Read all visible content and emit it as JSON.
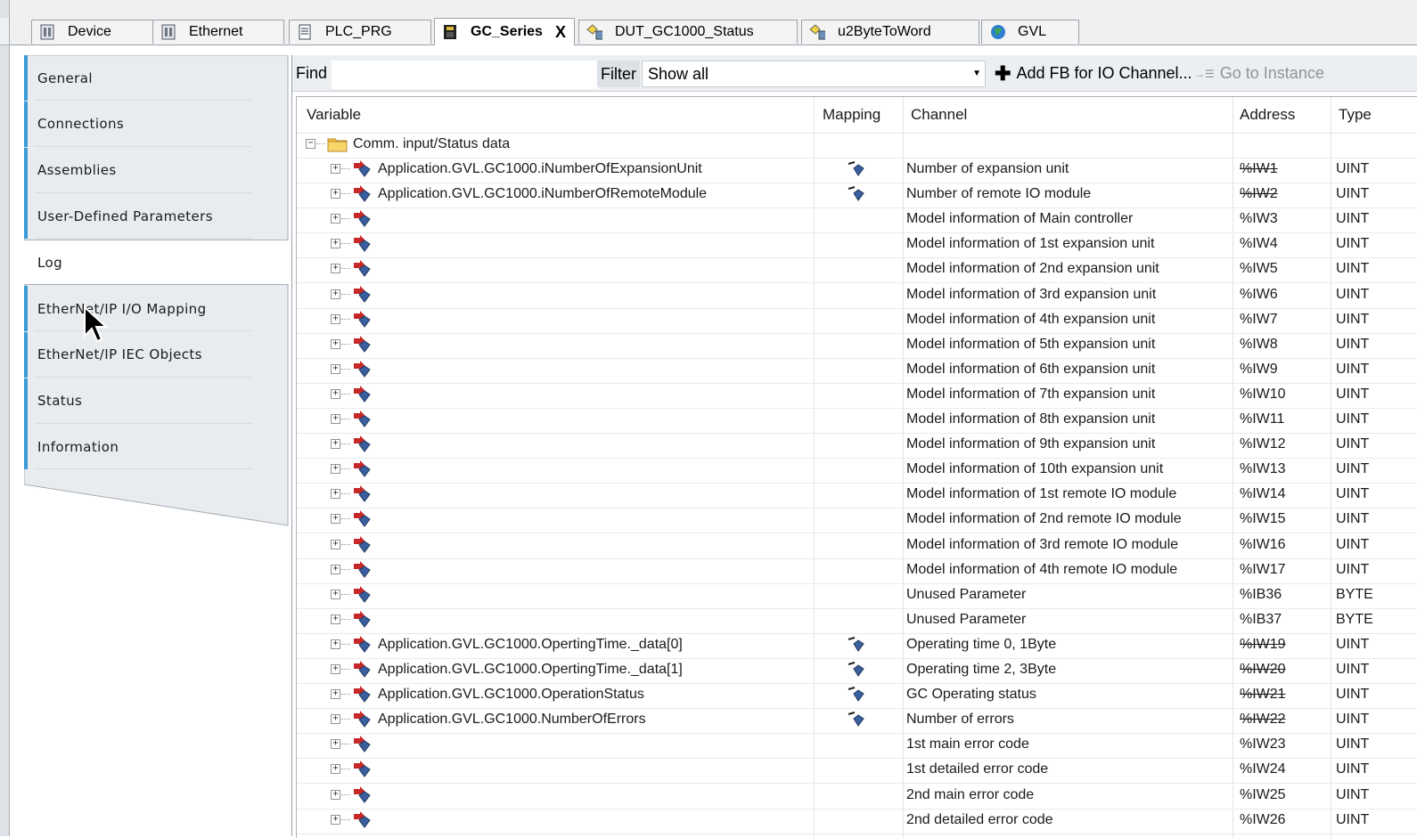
{
  "tabs": [
    {
      "label": "Device",
      "icon": "device-icon"
    },
    {
      "label": "Ethernet",
      "icon": "device-icon"
    },
    {
      "label": "PLC_PRG",
      "icon": "document-icon"
    },
    {
      "label": "GC_Series",
      "icon": "controller-icon",
      "active": true,
      "close": "X"
    },
    {
      "label": "DUT_GC1000_Status",
      "icon": "dut-icon"
    },
    {
      "label": "u2ByteToWord",
      "icon": "dut-icon"
    },
    {
      "label": "GVL",
      "icon": "globe-icon"
    }
  ],
  "nav": {
    "items": [
      {
        "label": "General"
      },
      {
        "label": "Connections"
      },
      {
        "label": "Assemblies"
      },
      {
        "label": "User-Defined Parameters"
      },
      {
        "label": "Log",
        "selected": true
      },
      {
        "label": "EtherNet/IP I/O Mapping"
      },
      {
        "label": "EtherNet/IP IEC Objects"
      },
      {
        "label": "Status"
      },
      {
        "label": "Information"
      }
    ]
  },
  "toolbar": {
    "find_label": "Find",
    "find_value": "",
    "filter_label": "Filter",
    "filter_value": "Show all",
    "add_fb_label": "Add FB for IO Channel...",
    "goto_label": "Go to Instance"
  },
  "table": {
    "headers": {
      "variable": "Variable",
      "mapping": "Mapping",
      "channel": "Channel",
      "address": "Address",
      "type": "Type"
    },
    "group_label": "Comm. input/Status data",
    "rows": [
      {
        "variable": "Application.GVL.GC1000.iNumberOfExpansionUnit",
        "mapped": true,
        "channel": "Number of expansion unit",
        "address": "%IW1",
        "struck": true,
        "type": "UINT"
      },
      {
        "variable": "Application.GVL.GC1000.iNumberOfRemoteModule",
        "mapped": true,
        "channel": "Number of remote IO module",
        "address": "%IW2",
        "struck": true,
        "type": "UINT"
      },
      {
        "variable": "",
        "mapped": false,
        "channel": "Model information of Main controller",
        "address": "%IW3",
        "struck": false,
        "type": "UINT"
      },
      {
        "variable": "",
        "mapped": false,
        "channel": "Model information of 1st expansion unit",
        "address": "%IW4",
        "struck": false,
        "type": "UINT"
      },
      {
        "variable": "",
        "mapped": false,
        "channel": "Model information of 2nd expansion unit",
        "address": "%IW5",
        "struck": false,
        "type": "UINT"
      },
      {
        "variable": "",
        "mapped": false,
        "channel": "Model information of 3rd expansion unit",
        "address": "%IW6",
        "struck": false,
        "type": "UINT"
      },
      {
        "variable": "",
        "mapped": false,
        "channel": "Model information of 4th expansion unit",
        "address": "%IW7",
        "struck": false,
        "type": "UINT"
      },
      {
        "variable": "",
        "mapped": false,
        "channel": "Model information of 5th expansion unit",
        "address": "%IW8",
        "struck": false,
        "type": "UINT"
      },
      {
        "variable": "",
        "mapped": false,
        "channel": "Model information of 6th expansion unit",
        "address": "%IW9",
        "struck": false,
        "type": "UINT"
      },
      {
        "variable": "",
        "mapped": false,
        "channel": "Model information of 7th expansion unit",
        "address": "%IW10",
        "struck": false,
        "type": "UINT"
      },
      {
        "variable": "",
        "mapped": false,
        "channel": "Model information of 8th expansion unit",
        "address": "%IW11",
        "struck": false,
        "type": "UINT"
      },
      {
        "variable": "",
        "mapped": false,
        "channel": "Model information of 9th expansion unit",
        "address": "%IW12",
        "struck": false,
        "type": "UINT"
      },
      {
        "variable": "",
        "mapped": false,
        "channel": "Model information of 10th expansion unit",
        "address": "%IW13",
        "struck": false,
        "type": "UINT"
      },
      {
        "variable": "",
        "mapped": false,
        "channel": "Model information of 1st remote IO module",
        "address": "%IW14",
        "struck": false,
        "type": "UINT"
      },
      {
        "variable": "",
        "mapped": false,
        "channel": "Model information of 2nd remote IO module",
        "address": "%IW15",
        "struck": false,
        "type": "UINT"
      },
      {
        "variable": "",
        "mapped": false,
        "channel": "Model information of 3rd remote IO module",
        "address": "%IW16",
        "struck": false,
        "type": "UINT"
      },
      {
        "variable": "",
        "mapped": false,
        "channel": "Model information of 4th remote IO module",
        "address": "%IW17",
        "struck": false,
        "type": "UINT"
      },
      {
        "variable": "",
        "mapped": false,
        "channel": "Unused Parameter",
        "address": "%IB36",
        "struck": false,
        "type": "BYTE"
      },
      {
        "variable": "",
        "mapped": false,
        "channel": "Unused Parameter",
        "address": "%IB37",
        "struck": false,
        "type": "BYTE"
      },
      {
        "variable": "Application.GVL.GC1000.OpertingTime._data[0]",
        "mapped": true,
        "channel": "Operating time 0, 1Byte",
        "address": "%IW19",
        "struck": true,
        "type": "UINT"
      },
      {
        "variable": "Application.GVL.GC1000.OpertingTime._data[1]",
        "mapped": true,
        "channel": "Operating time 2, 3Byte",
        "address": "%IW20",
        "struck": true,
        "type": "UINT"
      },
      {
        "variable": "Application.GVL.GC1000.OperationStatus",
        "mapped": true,
        "channel": "GC Operating status",
        "address": "%IW21",
        "struck": true,
        "type": "UINT"
      },
      {
        "variable": "Application.GVL.GC1000.NumberOfErrors",
        "mapped": true,
        "channel": "Number of errors",
        "address": "%IW22",
        "struck": true,
        "type": "UINT"
      },
      {
        "variable": "",
        "mapped": false,
        "channel": "1st main error code",
        "address": "%IW23",
        "struck": false,
        "type": "UINT"
      },
      {
        "variable": "",
        "mapped": false,
        "channel": "1st detailed error code",
        "address": "%IW24",
        "struck": false,
        "type": "UINT"
      },
      {
        "variable": "",
        "mapped": false,
        "channel": "2nd main error code",
        "address": "%IW25",
        "struck": false,
        "type": "UINT"
      },
      {
        "variable": "",
        "mapped": false,
        "channel": "2nd detailed error code",
        "address": "%IW26",
        "struck": false,
        "type": "UINT"
      }
    ]
  },
  "colors": {
    "accent": "#3b9bd8",
    "tab_strip": "#f0f0f0"
  }
}
